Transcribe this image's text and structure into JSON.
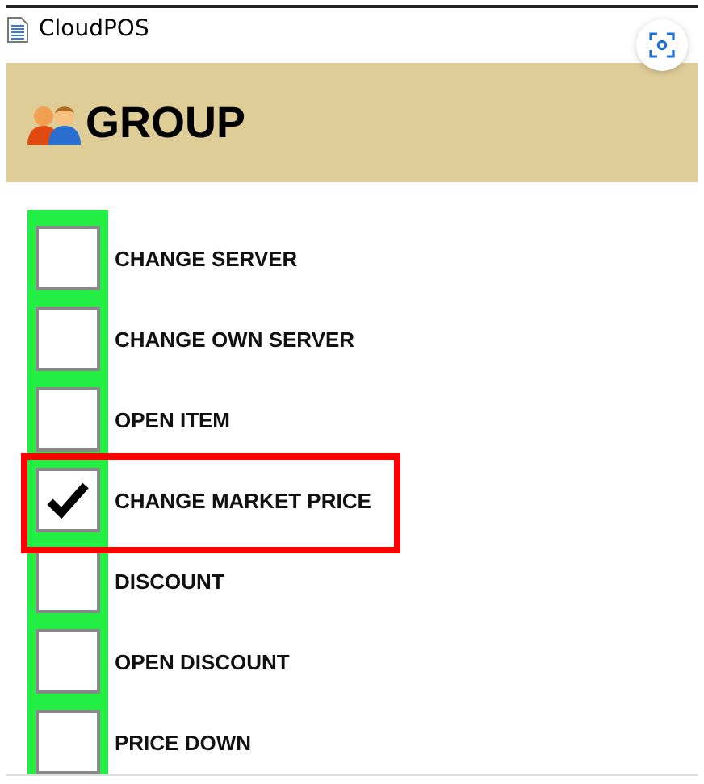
{
  "window": {
    "title": "CloudPOS"
  },
  "header": {
    "title": "GROUP"
  },
  "items": [
    {
      "label": "CHANGE SERVER",
      "checked": false,
      "highlighted": false
    },
    {
      "label": "CHANGE OWN SERVER",
      "checked": false,
      "highlighted": false
    },
    {
      "label": "OPEN ITEM",
      "checked": false,
      "highlighted": false
    },
    {
      "label": "CHANGE MARKET PRICE",
      "checked": true,
      "highlighted": true
    },
    {
      "label": "DISCOUNT",
      "checked": false,
      "highlighted": false
    },
    {
      "label": "OPEN DISCOUNT",
      "checked": false,
      "highlighted": false
    },
    {
      "label": "PRICE DOWN",
      "checked": false,
      "highlighted": false
    }
  ]
}
